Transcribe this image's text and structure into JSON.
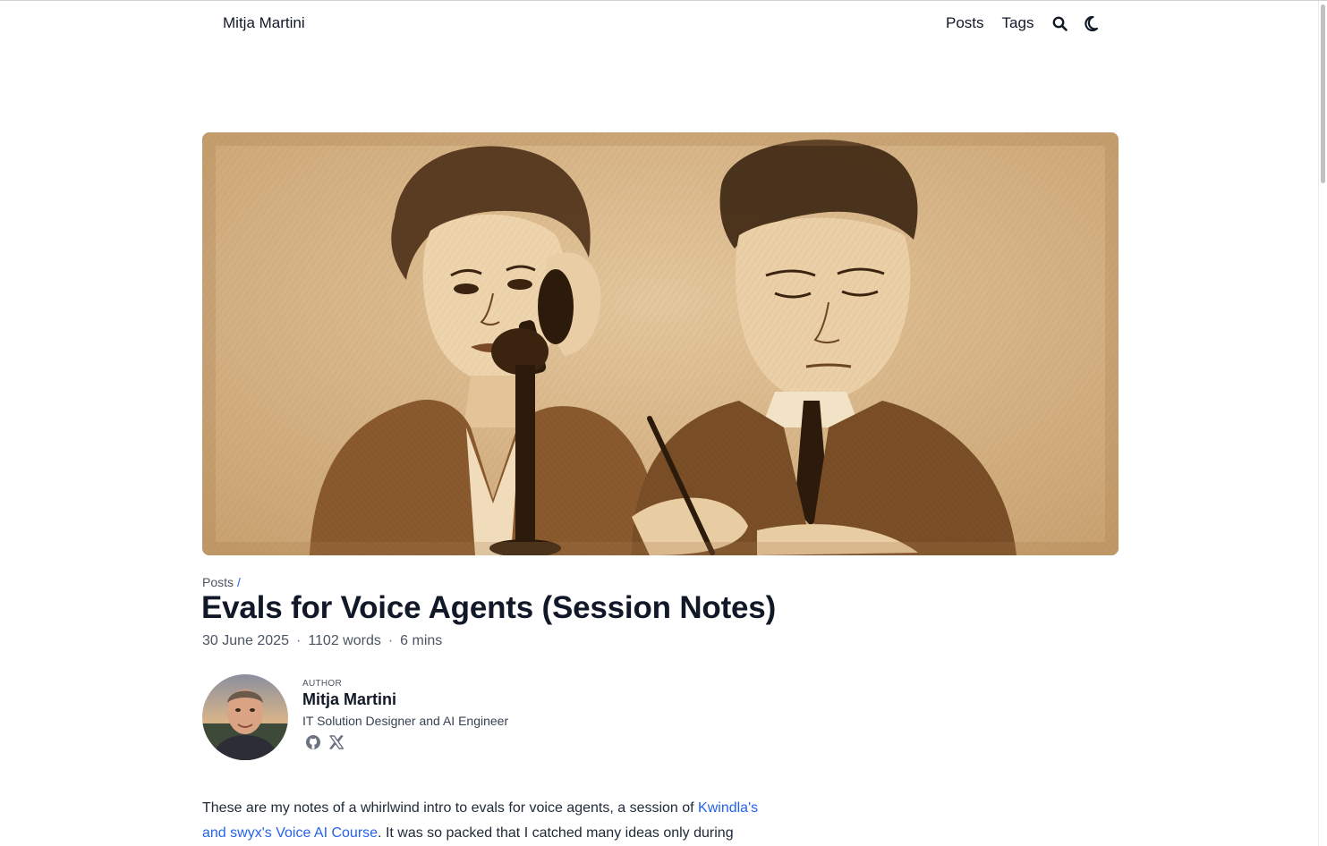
{
  "header": {
    "site_title": "Mitja Martini",
    "nav": {
      "posts": "Posts",
      "tags": "Tags"
    },
    "icons": [
      "search-icon",
      "moon-icon"
    ]
  },
  "hero": {
    "icon": "sepia-illustration-woman-on-telephone-and-man-writing"
  },
  "breadcrumb": {
    "posts": "Posts",
    "separator": "/"
  },
  "post": {
    "title": "Evals for Voice Agents (Session Notes)",
    "date": "30 June 2025",
    "words": "1102 words",
    "read_time": "6 mins",
    "meta_separator": "·"
  },
  "author": {
    "label": "AUTHOR",
    "name": "Mitja Martini",
    "bio": "IT Solution Designer and AI Engineer",
    "links": [
      "github-icon",
      "x-icon"
    ]
  },
  "body": {
    "intro_before_link": "These are my notes of a whirlwind intro to evals for voice agents, a session of ",
    "link_text": "Kwindla's and swyx's Voice AI Course",
    "intro_after_link": ". It was so packed that I catched many ideas only during"
  },
  "colors": {
    "link": "#2563eb",
    "text": "#111827",
    "muted": "#4b5563",
    "hero_sepia": "#d8b88a"
  }
}
